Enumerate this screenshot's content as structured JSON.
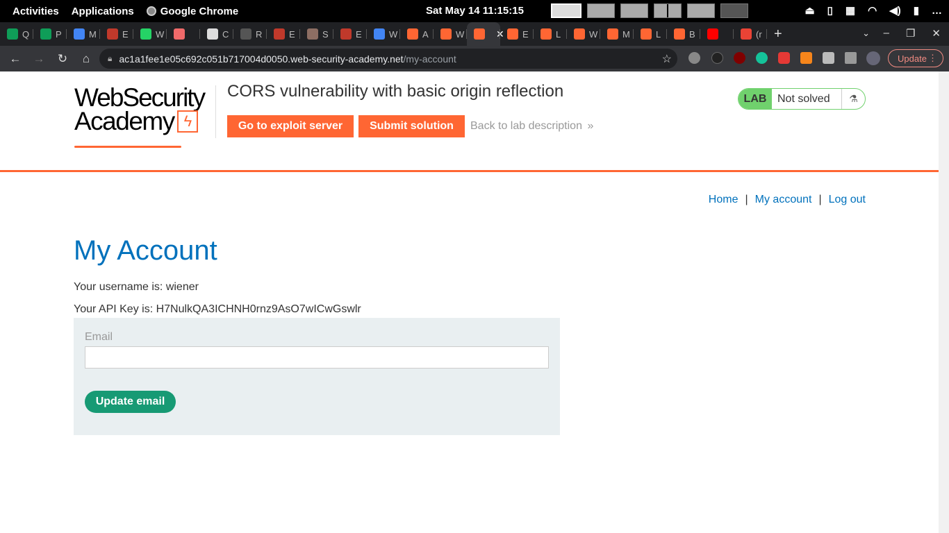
{
  "system_bar": {
    "activities": "Activities",
    "applications": "Applications",
    "active_app": "Google Chrome",
    "clock": "Sat May 14  11:15:15"
  },
  "browser": {
    "tabs": [
      {
        "label": "Q",
        "icon": "sheets-icon",
        "color": "#0f9d58"
      },
      {
        "label": "P",
        "icon": "sheets-icon",
        "color": "#0f9d58"
      },
      {
        "label": "M",
        "icon": "drive-icon",
        "color": "#4285f4"
      },
      {
        "label": "E",
        "icon": "portswigger-lab-icon",
        "color": "#c0392b"
      },
      {
        "label": "W",
        "icon": "whatsapp-icon",
        "color": "#25d366"
      },
      {
        "label": "",
        "icon": "asana-icon",
        "color": "#f06a6a"
      },
      {
        "label": "C",
        "icon": "globe-icon",
        "color": "#dddddd"
      },
      {
        "label": "R",
        "icon": "loading-icon",
        "color": "#555555"
      },
      {
        "label": "E",
        "icon": "portswigger-lab-icon",
        "color": "#c0392b"
      },
      {
        "label": "S",
        "icon": "avatar-icon",
        "color": "#8d6e63"
      },
      {
        "label": "E",
        "icon": "portswigger-lab-icon",
        "color": "#c0392b"
      },
      {
        "label": "W",
        "icon": "google-icon",
        "color": "#4285f4"
      },
      {
        "label": "A",
        "icon": "burp-icon",
        "color": "#ff6633"
      },
      {
        "label": "W",
        "icon": "burp-icon",
        "color": "#ff6633"
      },
      {
        "label": "",
        "icon": "burp-icon",
        "color": "#ff6633",
        "active": true
      },
      {
        "label": "E",
        "icon": "burp-icon",
        "color": "#ff6633"
      },
      {
        "label": "L",
        "icon": "burp-icon",
        "color": "#ff6633"
      },
      {
        "label": "W",
        "icon": "burp-icon",
        "color": "#ff6633"
      },
      {
        "label": "M",
        "icon": "burp-icon",
        "color": "#ff6633"
      },
      {
        "label": "L",
        "icon": "burp-icon",
        "color": "#ff6633"
      },
      {
        "label": "B",
        "icon": "burp-icon",
        "color": "#ff6633"
      },
      {
        "label": "",
        "icon": "youtube-icon",
        "color": "#ff0000"
      },
      {
        "label": "(r",
        "icon": "gmail-icon",
        "color": "#ea4335"
      }
    ],
    "url_host": "ac1a1fee1e05c692c051b717004d0050.web-security-academy.net",
    "url_path": "/my-account",
    "update_label": "Update"
  },
  "header": {
    "logo_line1": "WebSecurity",
    "logo_line2": "Academy",
    "lab_title": "CORS vulnerability with basic origin reflection",
    "exploit_button": "Go to exploit server",
    "submit_button": "Submit solution",
    "back_link": "Back to lab description",
    "lab_badge": "LAB",
    "lab_status": "Not solved"
  },
  "nav": {
    "home": "Home",
    "my_account": "My account",
    "log_out": "Log out",
    "sep": "|"
  },
  "account": {
    "heading": "My Account",
    "username_text": "Your username is: wiener",
    "apikey_text": "Your API Key is: H7NulkQA3ICHNH0rnz9AsO7wICwGswlr",
    "email_label": "Email",
    "email_value": "",
    "update_button": "Update email"
  },
  "colors": {
    "accent": "#ff6633",
    "link": "#0071bc",
    "lab_green": "#70d16d",
    "update_green": "#179a74"
  }
}
